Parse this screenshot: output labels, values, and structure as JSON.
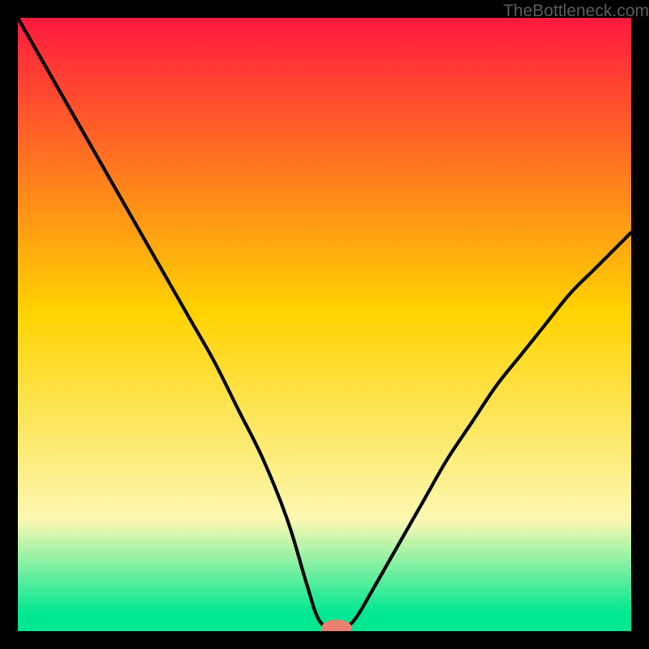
{
  "watermark": "TheBottleneck.com",
  "colors": {
    "top": "#ff193f",
    "mid": "#ffd300",
    "pale": "#fbf8b2",
    "green": "#00e891",
    "curve": "#000000",
    "marker": "#e88070",
    "frame": "#000000"
  },
  "chart_data": {
    "type": "line",
    "title": "",
    "xlabel": "",
    "ylabel": "",
    "xlim": [
      0,
      100
    ],
    "ylim": [
      0,
      100
    ],
    "x": [
      0,
      4,
      8,
      12,
      16,
      20,
      24,
      28,
      32,
      36,
      40,
      44,
      47,
      49,
      51,
      53,
      55,
      58,
      62,
      66,
      70,
      74,
      78,
      82,
      86,
      90,
      94,
      98,
      100
    ],
    "y": [
      100,
      93,
      86,
      79,
      72,
      65,
      58,
      51,
      44,
      36,
      28,
      18,
      8,
      2,
      0.5,
      0.5,
      2,
      7,
      14,
      21,
      28,
      34,
      40,
      45,
      50,
      55,
      59,
      63,
      65
    ],
    "marker": {
      "x": 52,
      "y": 0.5,
      "rx": 2.5,
      "ry": 1.4
    },
    "gradient_stops": [
      {
        "offset": 0,
        "key": "top"
      },
      {
        "offset": 48,
        "key": "mid"
      },
      {
        "offset": 82,
        "key": "pale"
      },
      {
        "offset": 97,
        "key": "green"
      },
      {
        "offset": 100,
        "key": "green"
      }
    ]
  }
}
